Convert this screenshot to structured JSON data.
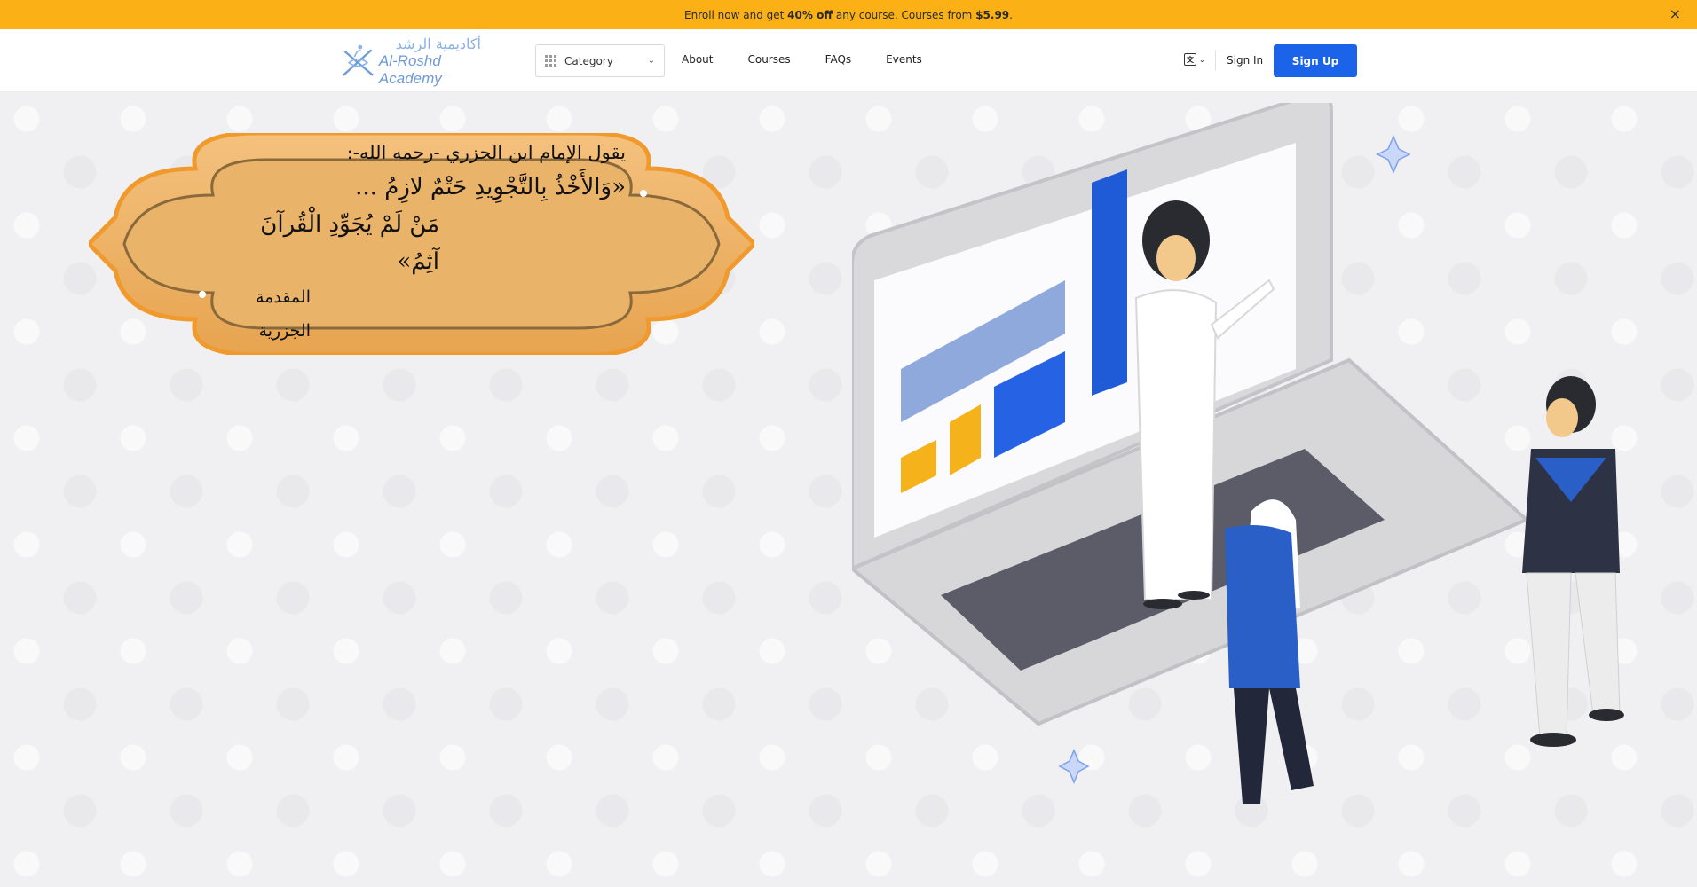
{
  "promo": {
    "prefix": "Enroll now and get ",
    "discount": "40% off",
    "middle": " any course. Courses from ",
    "price": "$5.99",
    "suffix": ".",
    "close": "×"
  },
  "header": {
    "logo": {
      "arabic": "أكاديمية الرشد",
      "english": "Al-Roshd Academy"
    },
    "category": {
      "label": "Category"
    },
    "nav": [
      {
        "label": "About"
      },
      {
        "label": "Courses"
      },
      {
        "label": "FAQs"
      },
      {
        "label": "Events"
      }
    ],
    "language_icon": "translate-icon",
    "sign_in": "Sign In",
    "sign_up": "Sign Up"
  },
  "hero": {
    "quote": {
      "line1": "يقول الإمام ابن الجزري -رحمه الله-:",
      "line2": "«وَالأَخْذُ بِالتَّجْوِيدِ حَتْمٌ لازِمُ ...",
      "line3": "مَنْ لَمْ يُجَوِّدِ الْقُرآنَ آثِمُ»",
      "source": "المقدمة الجزرية"
    }
  },
  "colors": {
    "promo_bg": "#fbb116",
    "primary_blue": "#1b63e8",
    "frame_orange": "#f3a24a"
  }
}
